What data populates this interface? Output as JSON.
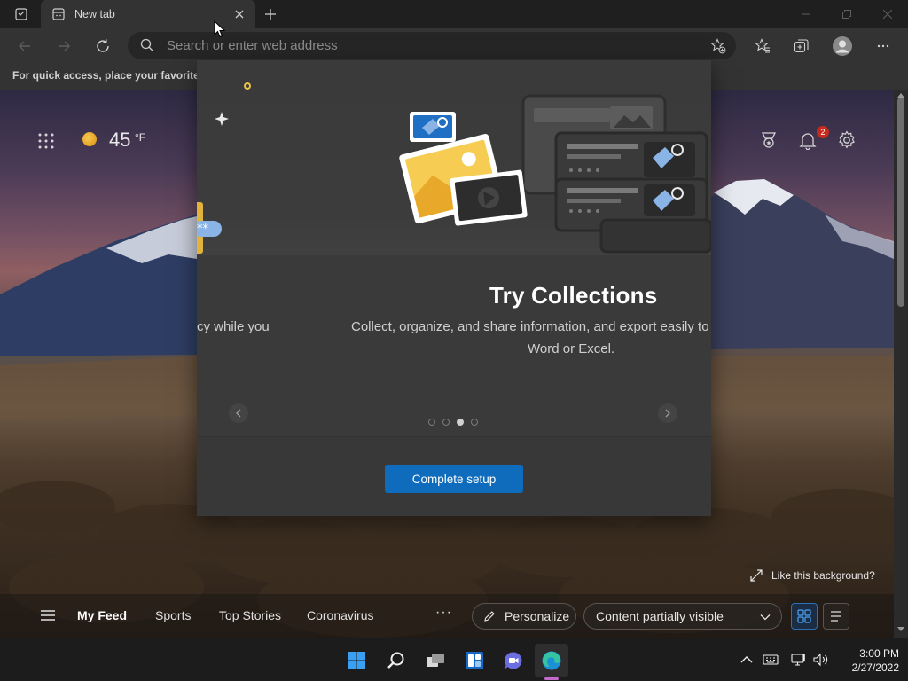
{
  "browser": {
    "tab": {
      "title": "New tab"
    },
    "address_bar": {
      "placeholder": "Search or enter web address"
    },
    "favorites_bar": {
      "text": "For quick access, place your favorites h"
    }
  },
  "newtab": {
    "weather": {
      "temp": "45",
      "unit": "°F"
    },
    "notifications": {
      "count": "2"
    },
    "like_background": "Like this background?",
    "feed": {
      "items": [
        "My Feed",
        "Sports",
        "Top Stories",
        "Coronavirus"
      ],
      "more": "···",
      "personalize": "Personalize",
      "content_visibility": "Content partially visible"
    }
  },
  "modal": {
    "prev_slide_text": "cy while you",
    "title": "Try Collections",
    "description_line1": "Collect, organize, and share information, and export easily to",
    "description_line2": "Word or Excel.",
    "slides_total": 4,
    "active_slide": 3,
    "primary_button": "Complete setup"
  },
  "taskbar": {
    "clock": {
      "time": "3:00 PM",
      "date": "2/27/2022"
    },
    "apps": [
      "start-icon",
      "search-icon",
      "task-view-icon",
      "widgets-icon",
      "chat-icon",
      "edge-icon"
    ]
  },
  "colors": {
    "accent": "#0f6cbd",
    "notification_badge": "#c42b1c",
    "running_indicator": "#c46ac9"
  }
}
